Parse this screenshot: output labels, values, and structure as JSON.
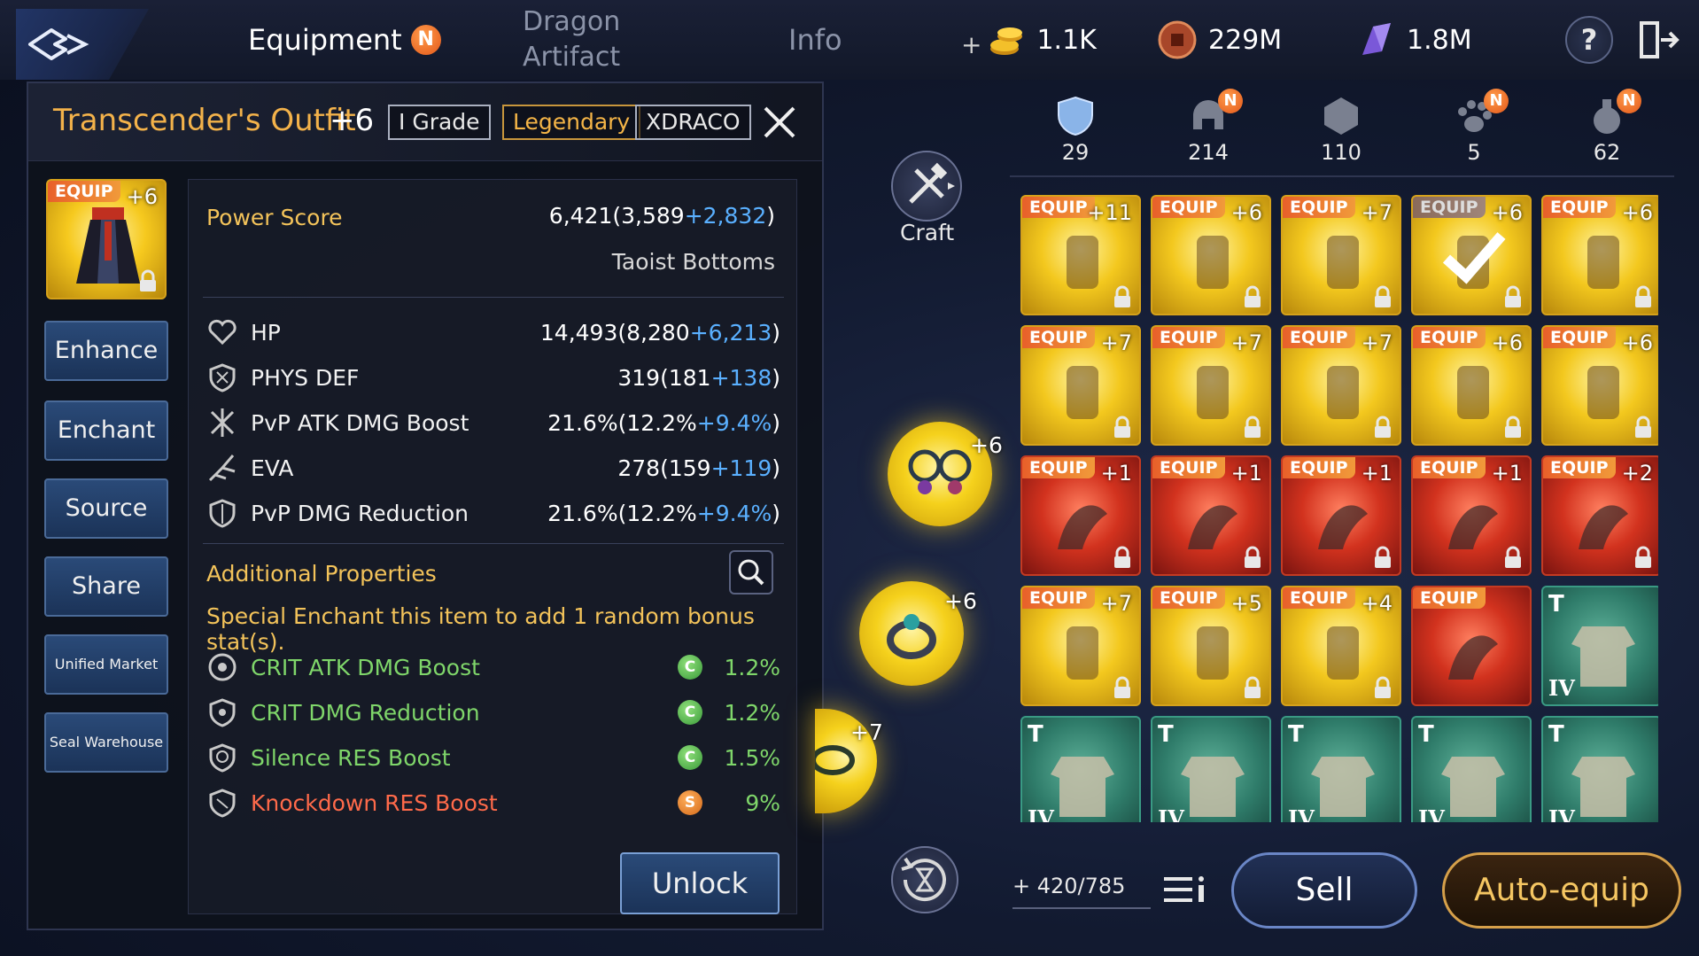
{
  "nav": {
    "tabs": [
      {
        "label": "Equipment",
        "badge": "N"
      },
      {
        "label": "Dragon",
        "label2": "Artifact"
      },
      {
        "label": "Info"
      }
    ]
  },
  "currencies": {
    "gold": {
      "plus": "+",
      "value": "1.1K",
      "icon": "gold-coins-icon"
    },
    "coin": {
      "value": "229M",
      "icon": "copper-coin-icon"
    },
    "gem": {
      "value": "1.8M",
      "icon": "crystal-icon"
    }
  },
  "help": {
    "label": "?"
  },
  "item": {
    "name": "Transcender's Outfit",
    "plus": "+6",
    "grade_tag": "I  Grade",
    "rarity_tag": "Legendary",
    "brand_tag": "XDRACO",
    "thumb": {
      "equip": "EQUIP",
      "plus": "+6"
    },
    "power_label": "Power Score",
    "power_value": "6,421(3,589",
    "power_bonus": "+2,832",
    "power_close": ")",
    "type": "Taoist Bottoms",
    "stats": [
      {
        "name": "HP",
        "value": "14,493(8,280",
        "bonus": "+6,213",
        "close": ")",
        "icon": "heart-icon"
      },
      {
        "name": "PHYS DEF",
        "value": "319(181",
        "bonus": "+138",
        "close": ")",
        "icon": "shield-icon"
      },
      {
        "name": "PvP ATK DMG Boost",
        "value": "21.6%(12.2%",
        "bonus": "+9.4%",
        "close": ")",
        "icon": "pvp-attack-icon"
      },
      {
        "name": "EVA",
        "value": "278(159",
        "bonus": "+119",
        "close": ")",
        "icon": "evasion-icon"
      },
      {
        "name": "PvP DMG Reduction",
        "value": "21.6%(12.2%",
        "bonus": "+9.4%",
        "close": ")",
        "icon": "pvp-defense-icon"
      }
    ],
    "additional_label": "Additional Properties",
    "special_text": "Special Enchant this item to add 1 random bonus stat(s).",
    "properties": [
      {
        "name": "CRIT ATK DMG Boost",
        "grade": "C",
        "value": "1.2%",
        "color": "green"
      },
      {
        "name": "CRIT DMG Reduction",
        "grade": "C",
        "value": "1.2%",
        "color": "green"
      },
      {
        "name": "Silence RES Boost",
        "grade": "C",
        "value": "1.5%",
        "color": "green"
      },
      {
        "name": "Knockdown RES Boost",
        "grade": "S",
        "value": "9%",
        "color": "red"
      }
    ]
  },
  "side_buttons": [
    "Enhance",
    "Enchant",
    "Source",
    "Share",
    "Unified Market",
    "Seal Warehouse"
  ],
  "unlock_label": "Unlock",
  "craft_label": "Craft",
  "orbs": [
    {
      "plus": "+6",
      "icon": "earrings-icon"
    },
    {
      "plus": "+6",
      "icon": "ring-icon"
    },
    {
      "plus": "+7",
      "icon": "bracelet-icon"
    }
  ],
  "categories": [
    {
      "count": "29",
      "icon": "armor-category-icon",
      "badge": ""
    },
    {
      "count": "214",
      "icon": "helmet-category-icon",
      "badge": "N"
    },
    {
      "count": "110",
      "icon": "gem-category-icon",
      "badge": ""
    },
    {
      "count": "5",
      "icon": "pet-paw-icon",
      "badge": "N"
    },
    {
      "count": "62",
      "icon": "potion-category-icon",
      "badge": "N"
    }
  ],
  "inventory": [
    {
      "equip": "EQUIP",
      "plus": "+11",
      "tier": "gold",
      "icon": "sword-icon",
      "lock": true
    },
    {
      "equip": "EQUIP",
      "plus": "+6",
      "tier": "gold",
      "icon": "scarf-icon",
      "lock": true
    },
    {
      "equip": "EQUIP",
      "plus": "+7",
      "tier": "gold",
      "icon": "chest-armor-icon",
      "lock": true
    },
    {
      "equip": "EQUIP",
      "plus": "+6",
      "tier": "gold",
      "icon": "skirt-selected-icon",
      "lock": true,
      "dim": true
    },
    {
      "equip": "EQUIP",
      "plus": "+6",
      "tier": "gold",
      "icon": "gauntlet-icon",
      "lock": true
    },
    {
      "equip": "EQUIP",
      "plus": "+7",
      "tier": "gold",
      "icon": "boots-icon",
      "lock": true
    },
    {
      "equip": "EQUIP",
      "plus": "+7",
      "tier": "gold",
      "icon": "necklace-icon",
      "lock": true
    },
    {
      "equip": "EQUIP",
      "plus": "+7",
      "tier": "gold",
      "icon": "bracelet-icon",
      "lock": true
    },
    {
      "equip": "EQUIP",
      "plus": "+6",
      "tier": "gold",
      "icon": "ring-icon",
      "lock": true
    },
    {
      "equip": "EQUIP",
      "plus": "+6",
      "tier": "gold",
      "icon": "earrings-icon",
      "lock": true
    },
    {
      "equip": "EQUIP",
      "plus": "+1",
      "tier": "red",
      "icon": "dragon-claw-icon",
      "lock": true
    },
    {
      "equip": "EQUIP",
      "plus": "+1",
      "tier": "red",
      "icon": "dragon-scale-icon",
      "lock": true
    },
    {
      "equip": "EQUIP",
      "plus": "+1",
      "tier": "red",
      "icon": "dragon-horn-icon",
      "lock": true
    },
    {
      "equip": "EQUIP",
      "plus": "+1",
      "tier": "red",
      "icon": "dragon-seal-icon",
      "lock": true
    },
    {
      "equip": "EQUIP",
      "plus": "+2",
      "tier": "red",
      "icon": "dragon-book-icon",
      "lock": true
    },
    {
      "equip": "EQUIP",
      "plus": "+7",
      "tier": "gold",
      "icon": "staff-icon",
      "lock": true
    },
    {
      "equip": "EQUIP",
      "plus": "+5",
      "tier": "gold",
      "icon": "gourd-icon",
      "lock": true
    },
    {
      "equip": "EQUIP",
      "plus": "+4",
      "tier": "gold",
      "icon": "scepter-icon",
      "lock": true
    },
    {
      "equip": "EQUIP",
      "plus": "",
      "tier": "red",
      "icon": "horse-mask-icon",
      "lock": false
    },
    {
      "equip": "",
      "plus": "",
      "tier": "green",
      "icon": "tunic-icon",
      "lock": false,
      "roman": "IV"
    },
    {
      "equip": "",
      "plus": "",
      "tier": "green",
      "icon": "robe-icon",
      "lock": false,
      "roman": "IV"
    },
    {
      "equip": "",
      "plus": "",
      "tier": "green",
      "icon": "gloves-icon",
      "lock": false,
      "roman": "IV"
    },
    {
      "equip": "",
      "plus": "",
      "tier": "green",
      "icon": "bracers-icon",
      "lock": false,
      "roman": "IV"
    },
    {
      "equip": "",
      "plus": "",
      "tier": "green",
      "icon": "bracers-icon",
      "lock": false,
      "roman": "IV"
    },
    {
      "equip": "",
      "plus": "",
      "tier": "green",
      "icon": "bracers-icon",
      "lock": false,
      "roman": "IV"
    }
  ],
  "capacity": "+ 420/785",
  "sell_label": "Sell",
  "auto_equip_label": "Auto-equip",
  "colors": {
    "accent_gold": "#f3b24a",
    "bonus_blue": "#5ab0ff",
    "prop_green": "#7fd66a",
    "prop_red": "#ff6a4a"
  }
}
